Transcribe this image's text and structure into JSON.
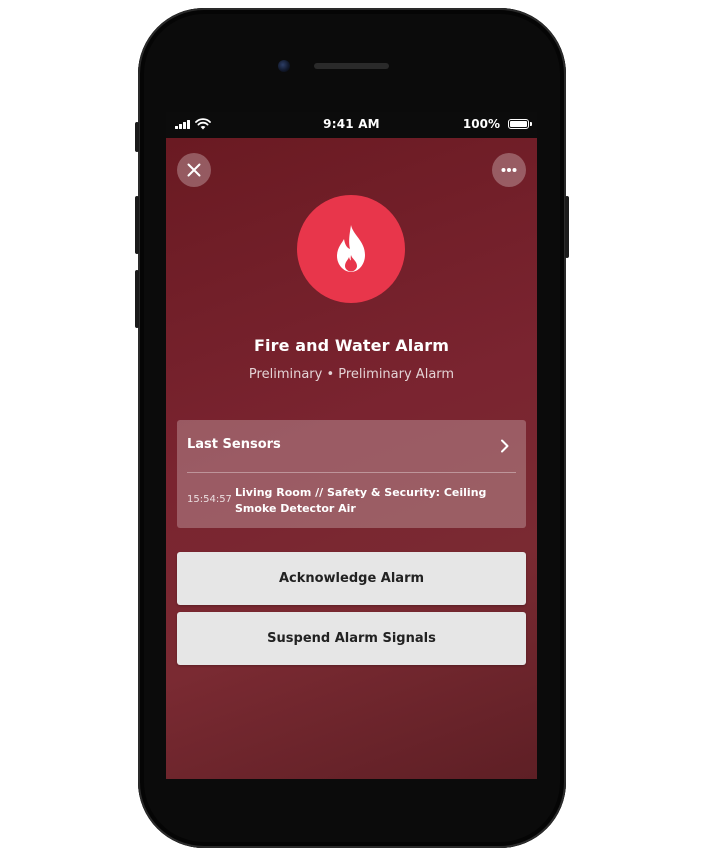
{
  "status_bar": {
    "time": "9:41 AM",
    "battery_percent": "100%",
    "signal_icon": "cellular-signal-icon",
    "wifi_icon": "wifi-icon",
    "battery_icon": "battery-icon"
  },
  "header": {
    "close_icon": "close-icon",
    "more_icon": "more-options-icon"
  },
  "alarm": {
    "icon": "fire-icon",
    "icon_color": "#e8364b",
    "title": "Fire and Water Alarm",
    "subtitle": "Preliminary • Preliminary Alarm"
  },
  "last_sensors": {
    "header": "Last Sensors",
    "items": [
      {
        "time": "15:54:57",
        "text": "Living Room // Safety & Security: Ceiling Smoke Detector Air"
      }
    ]
  },
  "actions": {
    "acknowledge_label": "Acknowledge Alarm",
    "suspend_label": "Suspend Alarm Signals"
  },
  "colors": {
    "background": "#6f1e27",
    "button": "#e6e6e6"
  }
}
